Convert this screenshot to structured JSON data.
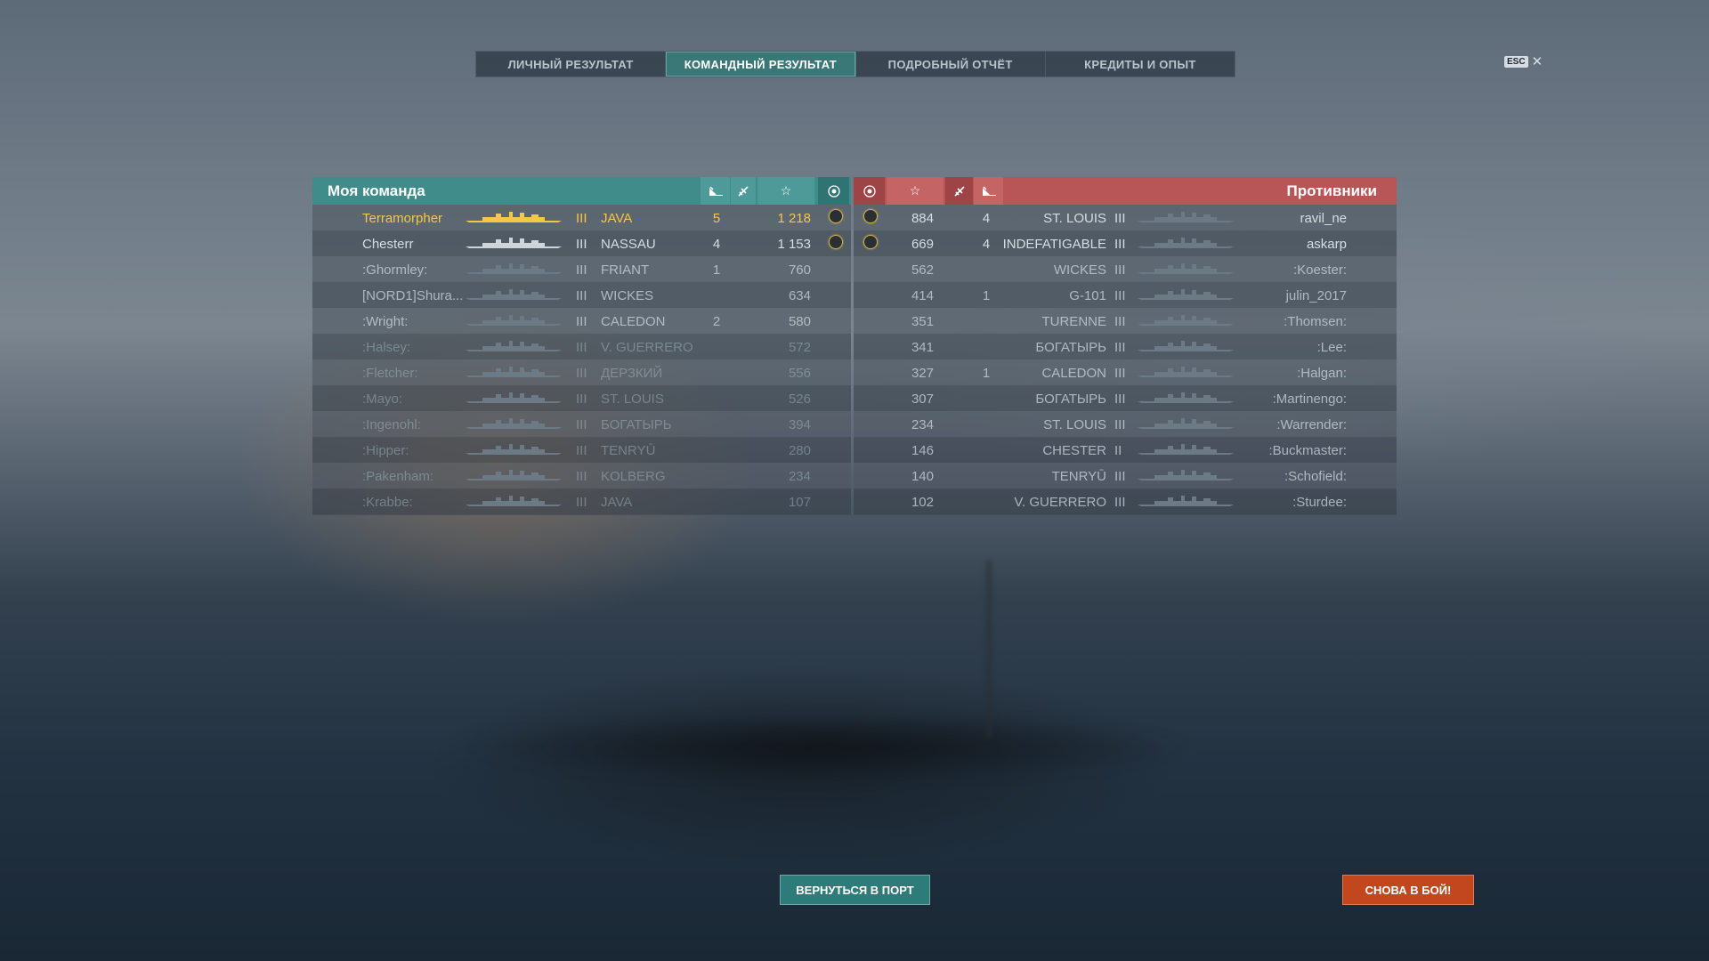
{
  "tabs": [
    {
      "label": "ЛИЧНЫЙ РЕЗУЛЬТАТ",
      "active": false
    },
    {
      "label": "КОМАНДНЫЙ РЕЗУЛЬТАТ",
      "active": true
    },
    {
      "label": "ПОДРОБНЫЙ ОТЧЁТ",
      "active": false
    },
    {
      "label": "КРЕДИТЫ И ОПЫТ",
      "active": false
    }
  ],
  "close": {
    "esc_label": "ESC",
    "close_symbol": "✕"
  },
  "my_team": {
    "title": "Моя команда",
    "header_icons": [
      "ship-kill-icon",
      "plane-kill-icon",
      "star-icon",
      "medal-icon"
    ],
    "rows": [
      {
        "player": "Terramorpher",
        "tier": "III",
        "ship": "JAVA",
        "kills": "5",
        "xp": "1 218",
        "medal": true
      },
      {
        "player": "Chesterr",
        "tier": "III",
        "ship": "NASSAU",
        "kills": "4",
        "xp": "1 153",
        "medal": true
      },
      {
        "player": ":Ghormley:",
        "tier": "III",
        "ship": "FRIANT",
        "kills": "1",
        "xp": "760",
        "medal": false
      },
      {
        "player": "[NORD1]Shura...",
        "tier": "III",
        "ship": "WICKES",
        "kills": "",
        "xp": "634",
        "medal": false
      },
      {
        "player": ":Wright:",
        "tier": "III",
        "ship": "CALEDON",
        "kills": "2",
        "xp": "580",
        "medal": false
      },
      {
        "player": ":Halsey:",
        "tier": "III",
        "ship": "V. GUERRERO",
        "kills": "",
        "xp": "572",
        "medal": false
      },
      {
        "player": ":Fletcher:",
        "tier": "III",
        "ship": "ДЕРЗКИЙ",
        "kills": "",
        "xp": "556",
        "medal": false
      },
      {
        "player": ":Mayo:",
        "tier": "III",
        "ship": "ST. LOUIS",
        "kills": "",
        "xp": "526",
        "medal": false
      },
      {
        "player": ":Ingenohl:",
        "tier": "III",
        "ship": "БОГАТЫРЬ",
        "kills": "",
        "xp": "394",
        "medal": false
      },
      {
        "player": ":Hipper:",
        "tier": "III",
        "ship": "TENRYŪ",
        "kills": "",
        "xp": "280",
        "medal": false
      },
      {
        "player": ":Pakenham:",
        "tier": "III",
        "ship": "KOLBERG",
        "kills": "",
        "xp": "234",
        "medal": false
      },
      {
        "player": ":Krabbe:",
        "tier": "III",
        "ship": "JAVA",
        "kills": "",
        "xp": "107",
        "medal": false
      }
    ]
  },
  "enemy_team": {
    "title": "Противники",
    "header_icons": [
      "medal-icon",
      "star-icon",
      "plane-kill-icon",
      "ship-kill-icon"
    ],
    "rows": [
      {
        "player": "ravil_ne",
        "tier": "III",
        "ship": "ST. LOUIS",
        "kills": "4",
        "xp": "884",
        "medal": true
      },
      {
        "player": "askarp",
        "tier": "III",
        "ship": "INDEFATIGABLE",
        "kills": "4",
        "xp": "669",
        "medal": true
      },
      {
        "player": ":Koester:",
        "tier": "III",
        "ship": "WICKES",
        "kills": "",
        "xp": "562",
        "medal": false
      },
      {
        "player": "julin_2017",
        "tier": "III",
        "ship": "G-101",
        "kills": "1",
        "xp": "414",
        "medal": false
      },
      {
        "player": ":Thomsen:",
        "tier": "III",
        "ship": "TURENNE",
        "kills": "",
        "xp": "351",
        "medal": false
      },
      {
        "player": ":Lee:",
        "tier": "III",
        "ship": "БОГАТЫРЬ",
        "kills": "",
        "xp": "341",
        "medal": false
      },
      {
        "player": ":Halgan:",
        "tier": "III",
        "ship": "CALEDON",
        "kills": "1",
        "xp": "327",
        "medal": false
      },
      {
        "player": ":Martinengo:",
        "tier": "III",
        "ship": "БОГАТЫРЬ",
        "kills": "",
        "xp": "307",
        "medal": false
      },
      {
        "player": ":Warrender:",
        "tier": "III",
        "ship": "ST. LOUIS",
        "kills": "",
        "xp": "234",
        "medal": false
      },
      {
        "player": ":Buckmaster:",
        "tier": "II",
        "ship": "CHESTER",
        "kills": "",
        "xp": "146",
        "medal": false
      },
      {
        "player": ":Schofield:",
        "tier": "III",
        "ship": "TENRYŪ",
        "kills": "",
        "xp": "140",
        "medal": false
      },
      {
        "player": ":Sturdee:",
        "tier": "III",
        "ship": "V. GUERRERO",
        "kills": "",
        "xp": "102",
        "medal": false
      }
    ]
  },
  "buttons": {
    "port": "ВЕРНУТЬСЯ В ПОРТ",
    "battle": "СНОВА В БОЙ!"
  },
  "colors": {
    "my_team": "#3f8c8a",
    "enemy_team": "#b85556",
    "highlight": "#f5c64a",
    "battle_button": "#c2471f"
  }
}
